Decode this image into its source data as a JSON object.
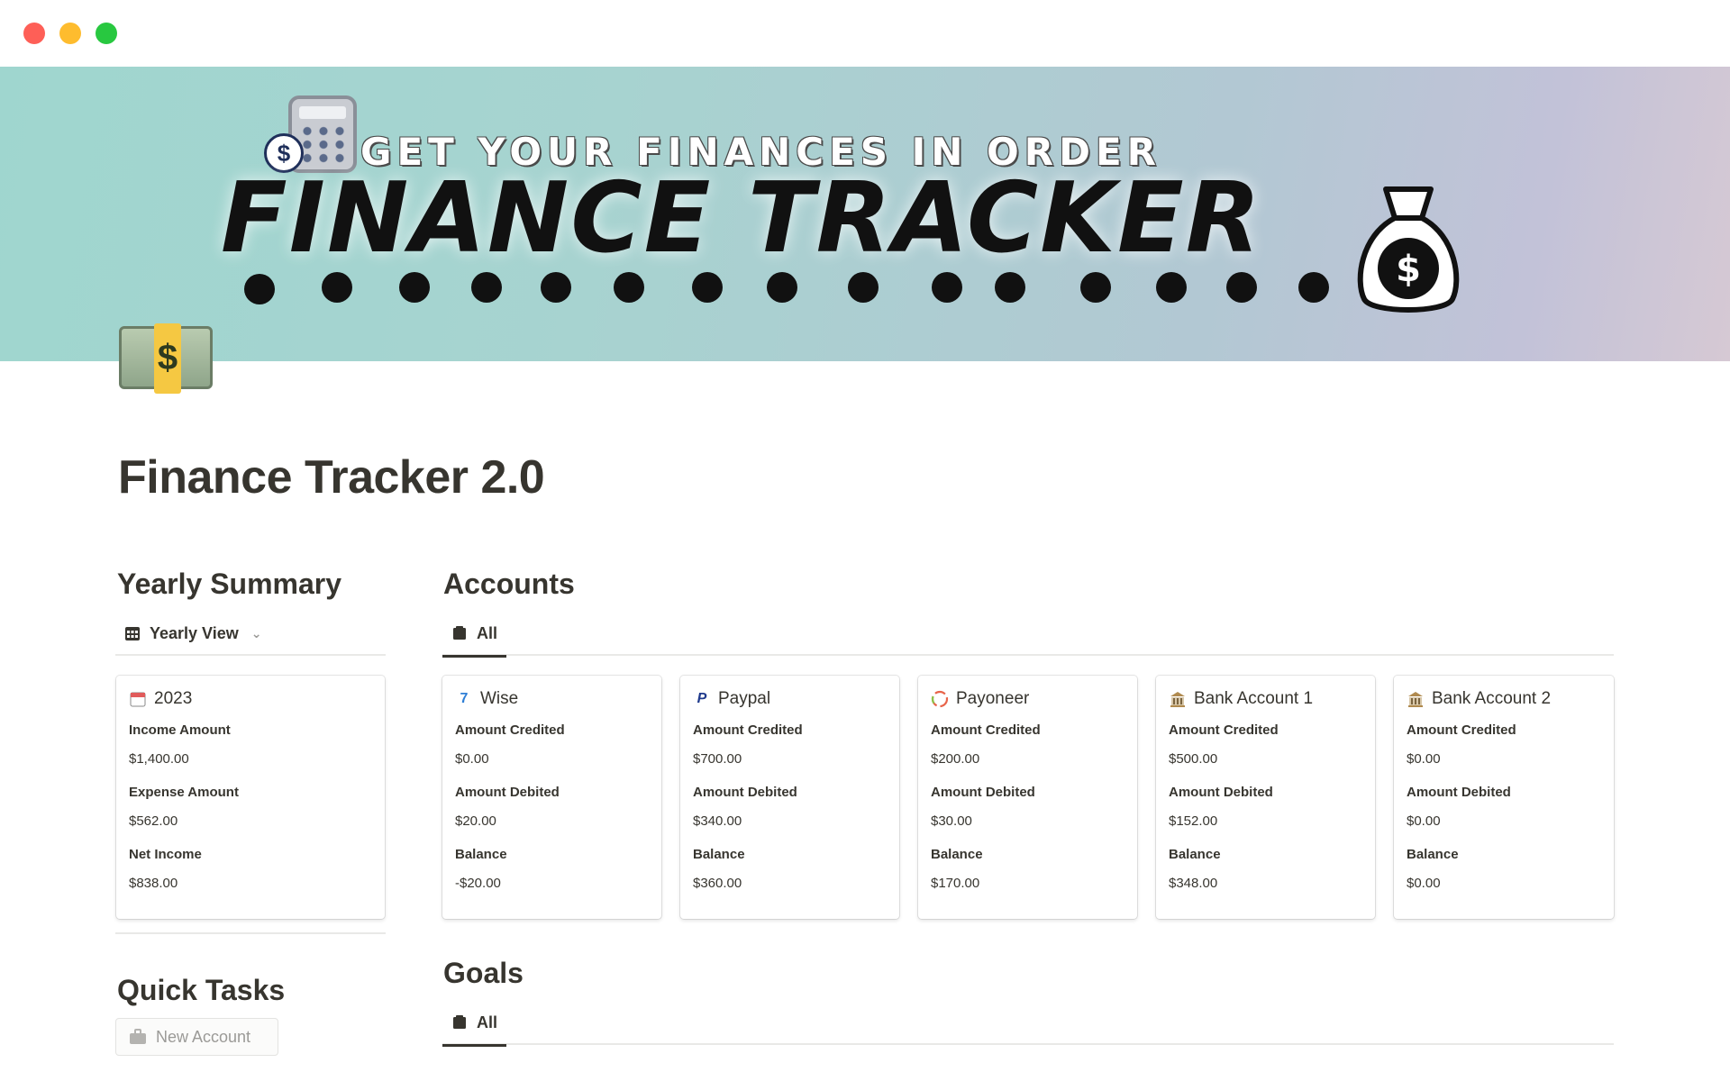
{
  "cover": {
    "subtitle": "GET YOUR FINANCES IN ORDER",
    "title": "FINANCE TRACKER",
    "coin_symbol": "$",
    "bag_symbol": "$"
  },
  "page": {
    "icon": "dollar-banknote-icon",
    "title": "Finance Tracker 2.0"
  },
  "yearly_summary": {
    "heading": "Yearly Summary",
    "view_tab": "Yearly View",
    "card": {
      "icon": "calendar-icon",
      "title": "2023",
      "props": [
        {
          "label": "Income Amount",
          "value": "$1,400.00"
        },
        {
          "label": "Expense Amount",
          "value": "$562.00"
        },
        {
          "label": "Net Income",
          "value": "$838.00"
        }
      ]
    }
  },
  "accounts": {
    "heading": "Accounts",
    "view_tab": "All",
    "cards": [
      {
        "icon": "wise-icon",
        "name": "Wise",
        "credited_label": "Amount Credited",
        "credited": "$0.00",
        "debited_label": "Amount Debited",
        "debited": "$20.00",
        "balance_label": "Balance",
        "balance": "-$20.00"
      },
      {
        "icon": "paypal-icon",
        "name": "Paypal",
        "credited_label": "Amount Credited",
        "credited": "$700.00",
        "debited_label": "Amount Debited",
        "debited": "$340.00",
        "balance_label": "Balance",
        "balance": "$360.00"
      },
      {
        "icon": "payoneer-icon",
        "name": "Payoneer",
        "credited_label": "Amount Credited",
        "credited": "$200.00",
        "debited_label": "Amount Debited",
        "debited": "$30.00",
        "balance_label": "Balance",
        "balance": "$170.00"
      },
      {
        "icon": "bank-icon",
        "name": "Bank Account 1",
        "credited_label": "Amount Credited",
        "credited": "$500.00",
        "debited_label": "Amount Debited",
        "debited": "$152.00",
        "balance_label": "Balance",
        "balance": "$348.00"
      },
      {
        "icon": "bank-icon",
        "name": "Bank Account 2",
        "credited_label": "Amount Credited",
        "credited": "$0.00",
        "debited_label": "Amount Debited",
        "debited": "$0.00",
        "balance_label": "Balance",
        "balance": "$0.00"
      }
    ]
  },
  "goals": {
    "heading": "Goals",
    "view_tab": "All"
  },
  "quick_tasks": {
    "heading": "Quick Tasks",
    "new_account": "New Account"
  },
  "colors": {
    "text": "#37352f",
    "muted": "#9b9a97",
    "traffic_red": "#fe5f57",
    "traffic_yellow": "#febc2e",
    "traffic_green": "#28c840",
    "wise": "#2f7fd6",
    "paypal": "#1f3a8c",
    "bank": "#b08a4f"
  }
}
